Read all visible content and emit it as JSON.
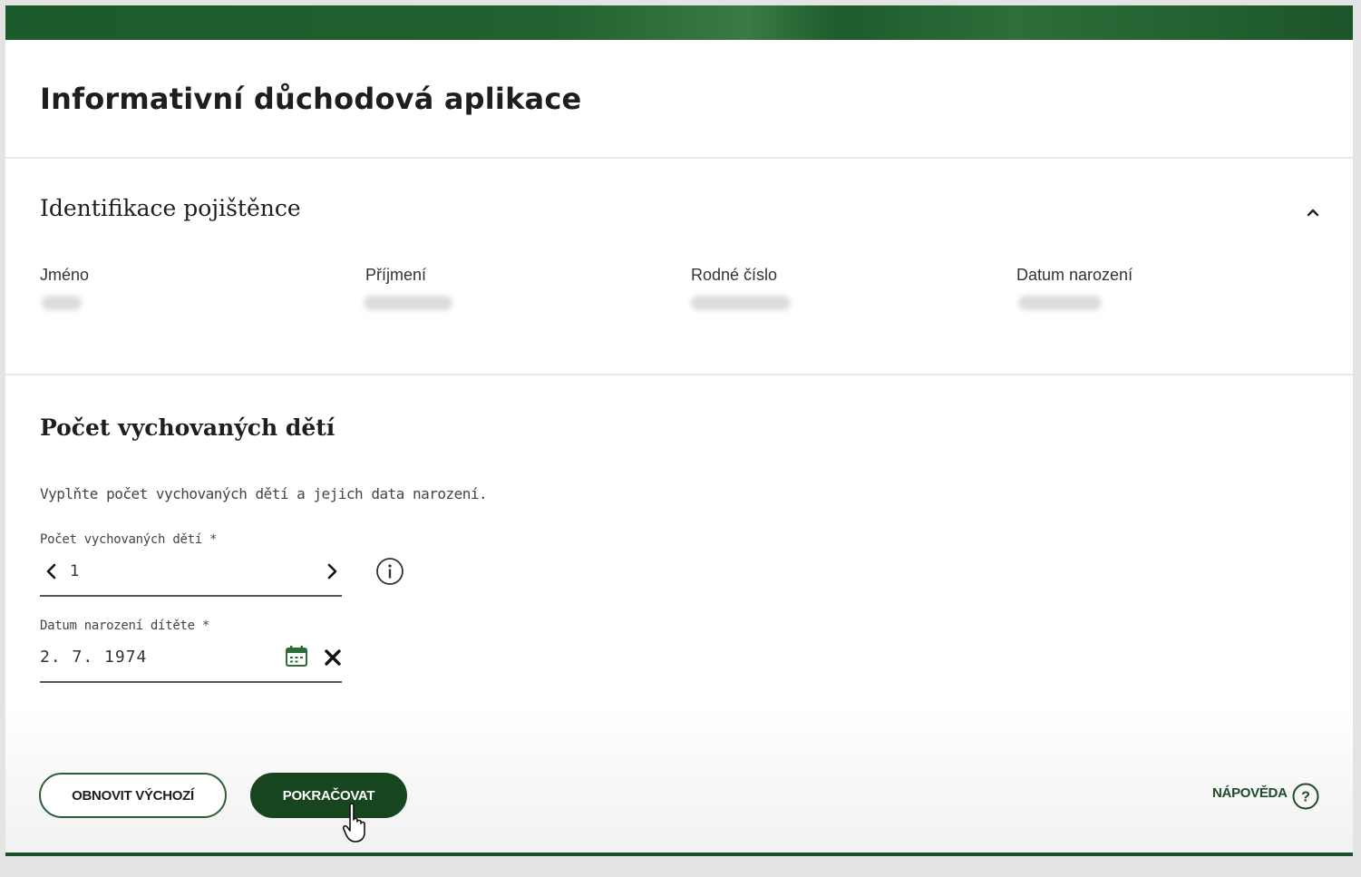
{
  "app": {
    "title": "Informativní důchodová aplikace",
    "brand_color": "#1d5a2c"
  },
  "identification": {
    "title": "Identifikace pojištěnce",
    "collapse_icon": "chevron-up-icon",
    "fields": [
      {
        "label": "Jméno"
      },
      {
        "label": "Příjmení"
      },
      {
        "label": "Rodné číslo"
      },
      {
        "label": "Datum narození"
      }
    ]
  },
  "children": {
    "title": "Počet vychovaných dětí",
    "instruction": "Vyplňte počet vychovaných dětí a jejich data narození.",
    "count_label": "Počet vychovaných dětí *",
    "count_value": "1",
    "birth_label": "Datum narození dítěte *",
    "birth_value": "2. 7. 1974"
  },
  "actions": {
    "reset_label": "OBNOVIT VÝCHOZÍ",
    "continue_label": "POKRAČOVAT",
    "help_label": "NÁPOVĚDA"
  }
}
